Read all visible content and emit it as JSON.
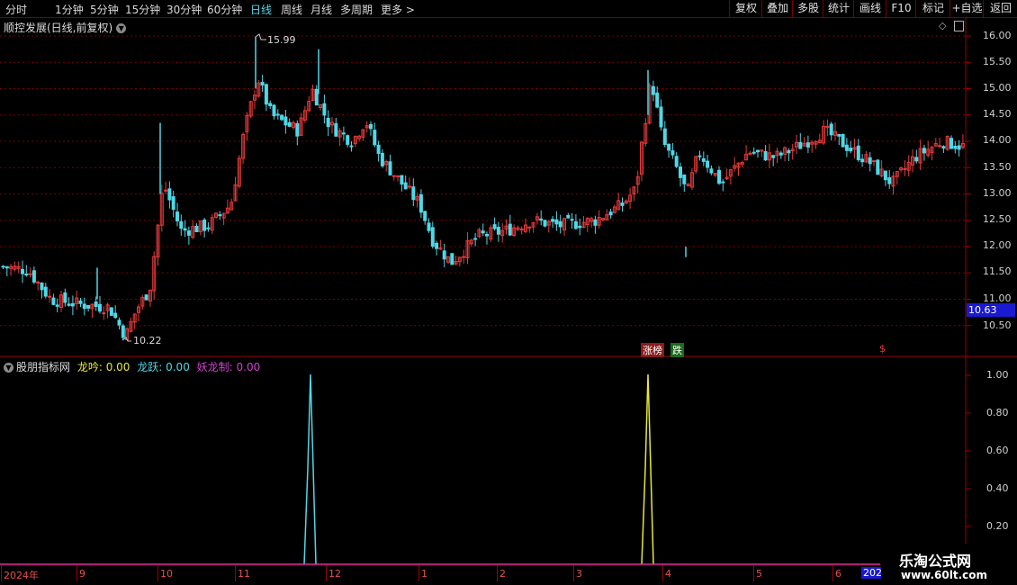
{
  "toolbar": {
    "periods": [
      "分时",
      "1分钟",
      "5分钟",
      "15分钟",
      "30分钟",
      "60分钟",
      "日线",
      "周线",
      "月线",
      "多周期",
      "更多 >"
    ],
    "active_period": "日线",
    "tools": [
      "复权",
      "叠加",
      "多股",
      "统计",
      "画线",
      "F10",
      "标记",
      "+自选",
      "返回"
    ]
  },
  "main": {
    "title": "顺控发展(日线,前复权)",
    "price_ticks": [
      "16.00",
      "15.50",
      "15.00",
      "14.50",
      "14.00",
      "13.50",
      "13.00",
      "12.50",
      "12.00",
      "11.50",
      "11.00",
      "10.50"
    ],
    "current_price": "10.63",
    "high_label": "15.99",
    "low_label": "10.22",
    "event_tags": [
      "涨榜",
      "跌"
    ],
    "s_marker": "$"
  },
  "indicator": {
    "name": "股朋指标网",
    "items": [
      {
        "label": "龙吟: 0.00",
        "color": "#e8e832"
      },
      {
        "label": "龙跃: 0.00",
        "color": "#4ed8e8"
      },
      {
        "label": "妖龙制: 0.00",
        "color": "#d040d0"
      }
    ],
    "ticks": [
      "1.00",
      "0.80",
      "0.60",
      "0.40",
      "0.20"
    ]
  },
  "dates": [
    "2024年",
    "9",
    "10",
    "11",
    "12",
    "1",
    "2",
    "3",
    "4",
    "5",
    "6",
    "202"
  ],
  "watermark": {
    "line1": "乐淘公式网",
    "line2": "www.60lt.com"
  },
  "colors": {
    "up": "#e83a3a",
    "down": "#4ed8e8",
    "grid": "#7a0000",
    "accent": "#1a1ad0"
  }
}
